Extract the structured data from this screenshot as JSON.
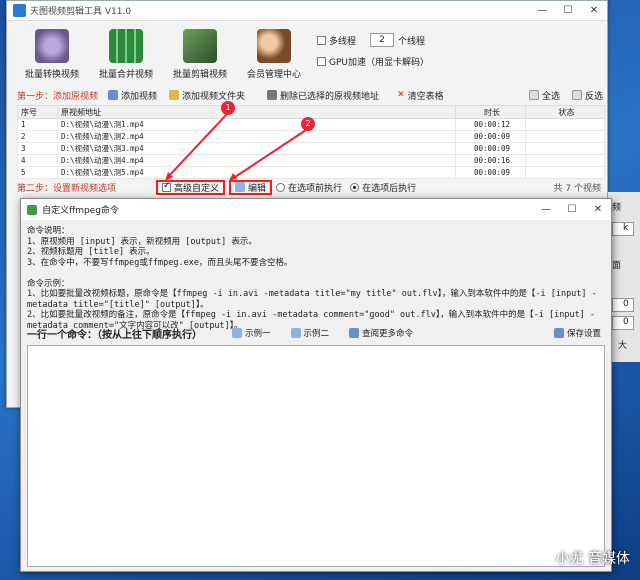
{
  "app": {
    "title": "天图视频剪辑工具 V11.0"
  },
  "tools": [
    {
      "label": "批量转换视频",
      "color": "#6a5a8c"
    },
    {
      "label": "批量合并视频",
      "color": "#2c8a3a"
    },
    {
      "label": "批量剪辑视频",
      "color": "#3a6a3a"
    },
    {
      "label": "会员管理中心",
      "color": "#7a4a2a"
    }
  ],
  "options": {
    "multithread": "多线程",
    "threads": "2",
    "threads_unit": "个线程",
    "gpu": "GPU加速（用显卡解码）"
  },
  "step1": {
    "label": "第一步：添加原视频",
    "add_video": "添加视频",
    "add_folder": "添加视频文件夹",
    "delete": "删除已选择的原视频地址",
    "clear": "清空表格",
    "select_all": "全选",
    "invert": "反选"
  },
  "table": {
    "headers": [
      "序号",
      "原视频地址",
      "时长",
      "状态"
    ],
    "rows": [
      [
        "1",
        "D:\\视频\\动漫\\测1.mp4",
        "00:00:12",
        ""
      ],
      [
        "2",
        "D:\\视频\\动漫\\测2.mp4",
        "00:00:09",
        ""
      ],
      [
        "3",
        "D:\\视频\\动漫\\测3.mp4",
        "00:00:09",
        ""
      ],
      [
        "4",
        "D:\\视频\\动漫\\测4.mp4",
        "00:00:16",
        ""
      ],
      [
        "5",
        "D:\\视频\\动漫\\测5.mp4",
        "00:00:09",
        ""
      ]
    ]
  },
  "step2": {
    "label": "第二步：设置新视频选项",
    "advanced": "高级自定义",
    "edit": "编辑",
    "before": "在选项前执行",
    "after": "在选项后执行",
    "count": "共 7 个视频"
  },
  "badges": [
    "1",
    "2"
  ],
  "dialog": {
    "title": "自定义ffmpeg命令",
    "info": "命令说明：\n1、原视频用 [input] 表示，新视频用 [output] 表示。\n2、视频标题用 [title] 表示。\n3、在命令中，不要写ffmpeg或ffmpeg.exe，而且头尾不要含空格。\n\n命令示例：\n1、比如要批量改视频标题，原命令是【ffmpeg -i in.avi -metadata title=\"my title\" out.flv】，输入到本软件中的是【-i [input] -metadata title=\"[title]\" [output]】。\n2、比如要批量改视频的备注，原命令是【ffmpeg -i in.avi -metadata comment=\"good\" out.flv】，输入到本软件中的是【-i [input] -metadata comment=\"文字内容可以改\" [output]】。",
    "cmd_title": "一行一个命令：（按从上往下顺序执行）",
    "example1": "示例一",
    "example2": "示例二",
    "more": "查阅更多命令",
    "save": "保存设置"
  },
  "right": {
    "labels": [
      "频",
      "k",
      "面",
      "0",
      "0",
      "大"
    ]
  },
  "watermark": "小尤 音媒体"
}
